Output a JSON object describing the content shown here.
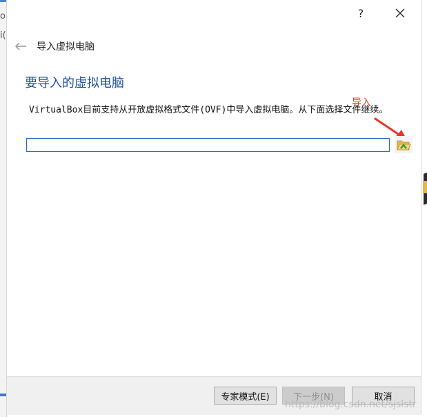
{
  "background": {
    "left_text_top": "o",
    "left_text_mid": "i("
  },
  "titlebar": {
    "help_label": "?",
    "close_glyph": "✕"
  },
  "header": {
    "wizard_title": "导入虚拟电脑"
  },
  "main": {
    "heading": "要导入的虚拟电脑",
    "description": "VirtualBox目前支持从开放虚拟格式文件(OVF)中导入虚拟电脑。从下面选择文件继续。",
    "file_input": {
      "value": "",
      "placeholder": ""
    },
    "annotation_label": "导入"
  },
  "footer": {
    "expert_label": "专家模式(E)",
    "next_label": "下一步(N)",
    "cancel_label": "取消"
  },
  "watermark": "https://blog.csdn.net/sjslstr",
  "colors": {
    "accent": "#1e4f9c",
    "input_border": "#1f6fc5",
    "annotation": "#e8352b"
  },
  "icons": [
    "back-arrow-icon",
    "folder-open-icon",
    "close-icon",
    "help-icon"
  ]
}
